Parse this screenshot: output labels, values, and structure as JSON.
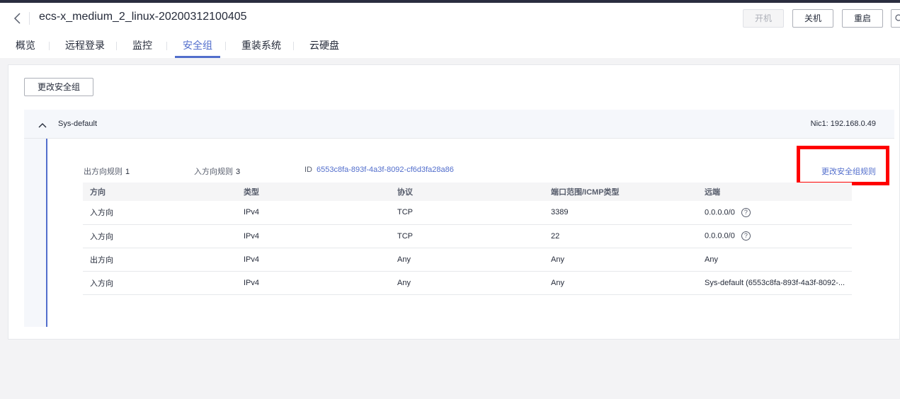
{
  "header": {
    "title": "ecs-x_medium_2_linux-20200312100405",
    "buttons": {
      "start": "开机",
      "stop": "关机",
      "restart": "重启"
    }
  },
  "tabs": [
    {
      "label": "概览"
    },
    {
      "label": "远程登录"
    },
    {
      "label": "监控"
    },
    {
      "label": "安全组"
    },
    {
      "label": "重装系统"
    },
    {
      "label": "云硬盘"
    }
  ],
  "actions": {
    "change_sg": "更改安全组"
  },
  "security_group": {
    "name": "Sys-default",
    "nic": "Nic1: 192.168.0.49",
    "outbound_label": "出方向规则",
    "outbound_count": "1",
    "inbound_label": "入方向规则",
    "inbound_count": "3",
    "id_label": "ID",
    "id_value": "6553c8fa-893f-4a3f-8092-cf6d3fa28a86",
    "edit_rules": "更改安全组规则"
  },
  "table": {
    "headers": [
      "方向",
      "类型",
      "协议",
      "端口范围/ICMP类型",
      "远端"
    ],
    "rows": [
      {
        "direction": "入方向",
        "type": "IPv4",
        "protocol": "TCP",
        "port": "3389",
        "remote": "0.0.0.0/0",
        "help": true
      },
      {
        "direction": "入方向",
        "type": "IPv4",
        "protocol": "TCP",
        "port": "22",
        "remote": "0.0.0.0/0",
        "help": true
      },
      {
        "direction": "出方向",
        "type": "IPv4",
        "protocol": "Any",
        "port": "Any",
        "remote": "Any",
        "help": false
      },
      {
        "direction": "入方向",
        "type": "IPv4",
        "protocol": "Any",
        "port": "Any",
        "remote": "Sys-default (6553c8fa-893f-4a3f-8092-...",
        "help": false
      }
    ]
  },
  "colors": {
    "accent": "#526ecc",
    "annotation": "#ff0000"
  }
}
